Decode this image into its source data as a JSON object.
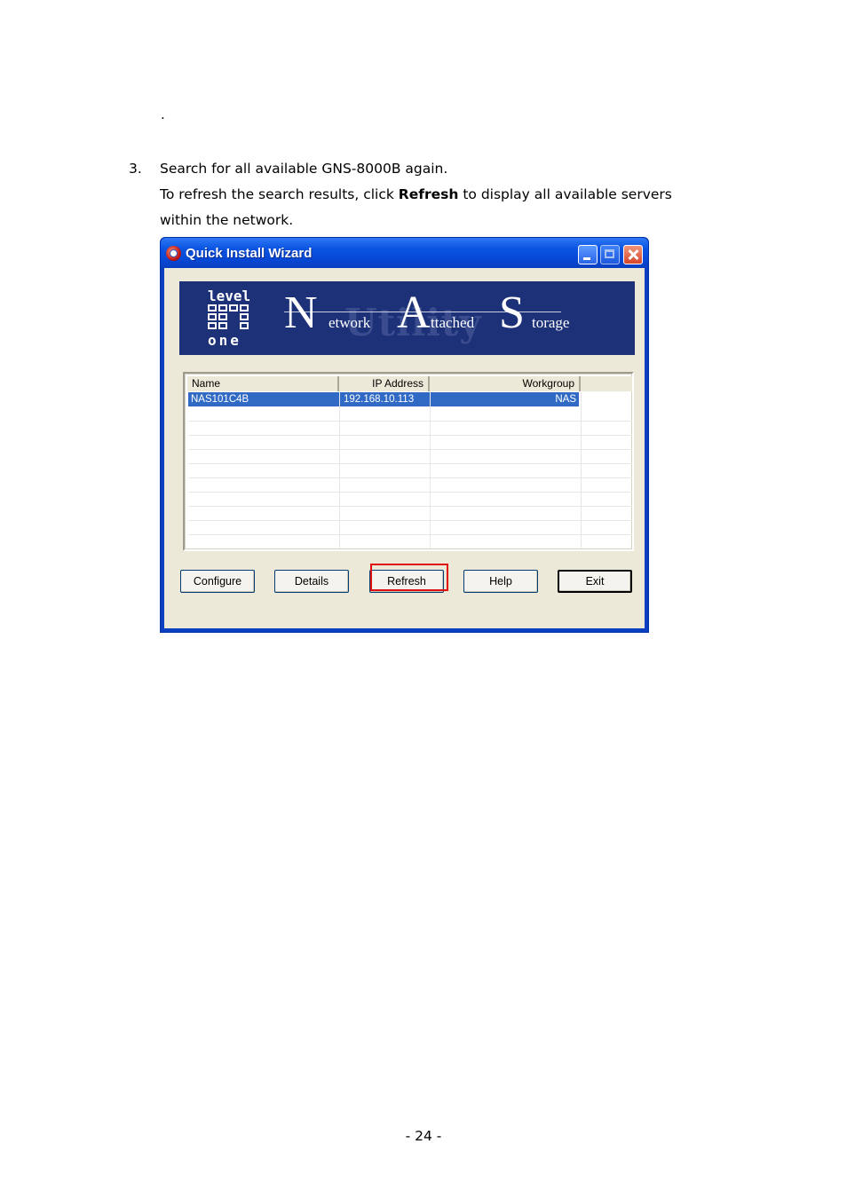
{
  "document": {
    "bullet_dot": ".",
    "step_number": "3.",
    "step_line1": "Search for all available GNS-8000B again.",
    "step_line2_pre": "To refresh the search results, click ",
    "step_line2_bold": "Refresh",
    "step_line2_post": " to display all available servers",
    "step_line3": "within the network.",
    "page_number": "- 24 -"
  },
  "window": {
    "title": "Quick Install Wizard",
    "banner": {
      "logo_top": "level",
      "logo_bottom": "one",
      "watermark": "Utility",
      "letter_n": "N",
      "word_n": "etwork",
      "letter_a": "A",
      "word_a": "ttached",
      "letter_s": "S",
      "word_s": "torage"
    },
    "list": {
      "columns": [
        "Name",
        "IP Address",
        "Workgroup"
      ],
      "rows": [
        {
          "name": "NAS101C4B",
          "ip": "192.168.10.113",
          "workgroup": "NAS",
          "selected": true
        }
      ]
    },
    "buttons": {
      "configure": "Configure",
      "details": "Details",
      "refresh": "Refresh",
      "help": "Help",
      "exit": "Exit"
    },
    "colors": {
      "titlebar": "#0b55e3",
      "selection": "#316ac5",
      "banner": "#1d3178",
      "highlight": "#e01010"
    }
  }
}
